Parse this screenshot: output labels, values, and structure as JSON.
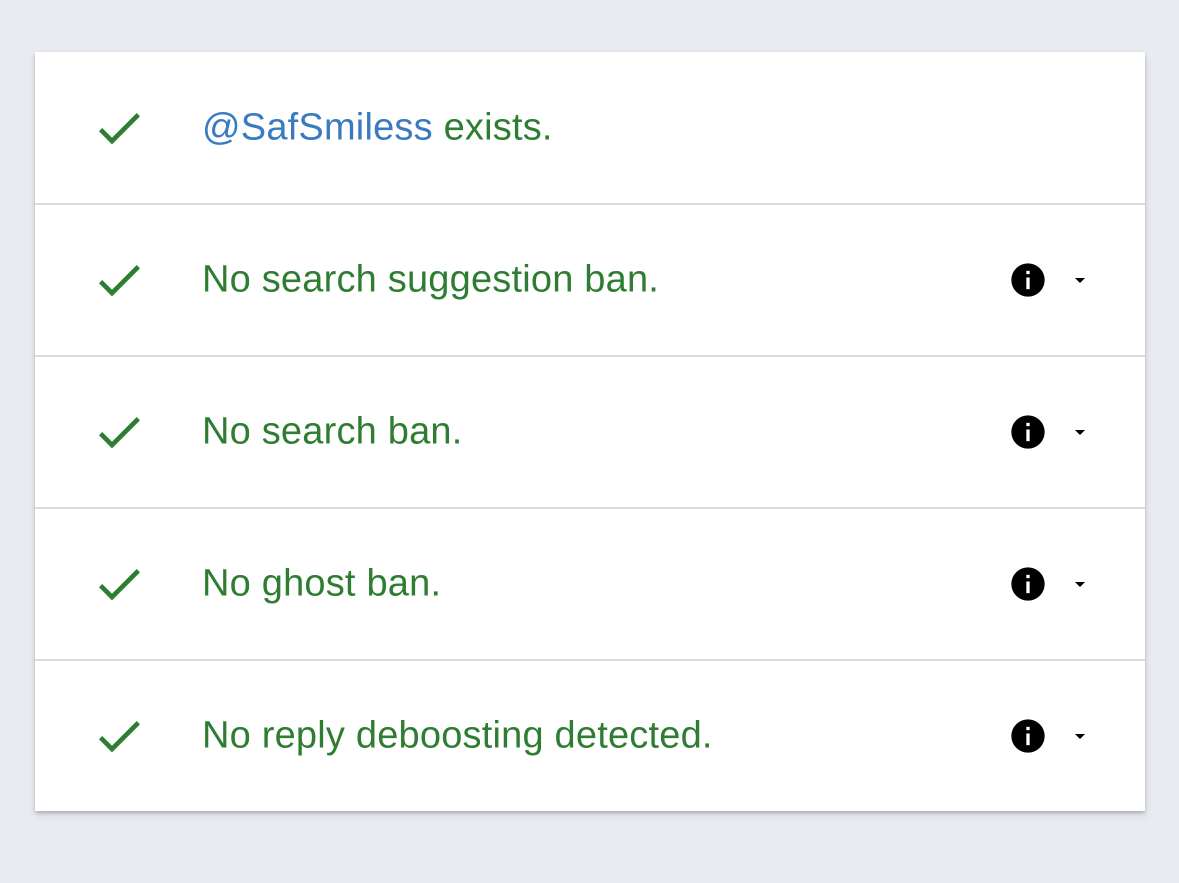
{
  "colors": {
    "background": "#e8ebf0",
    "card": "#ffffff",
    "success_green": "#2e7d32",
    "handle_blue": "#3a7bbf",
    "divider": "#dcdcdc"
  },
  "results": [
    {
      "icon": "check-icon",
      "handle": "@SafSmiless",
      "text": " exists.",
      "has_info": false
    },
    {
      "icon": "check-icon",
      "text": "No search suggestion ban.",
      "has_info": true
    },
    {
      "icon": "check-icon",
      "text": "No search ban.",
      "has_info": true
    },
    {
      "icon": "check-icon",
      "text": "No ghost ban.",
      "has_info": true
    },
    {
      "icon": "check-icon",
      "text": "No reply deboosting detected.",
      "has_info": true
    }
  ]
}
